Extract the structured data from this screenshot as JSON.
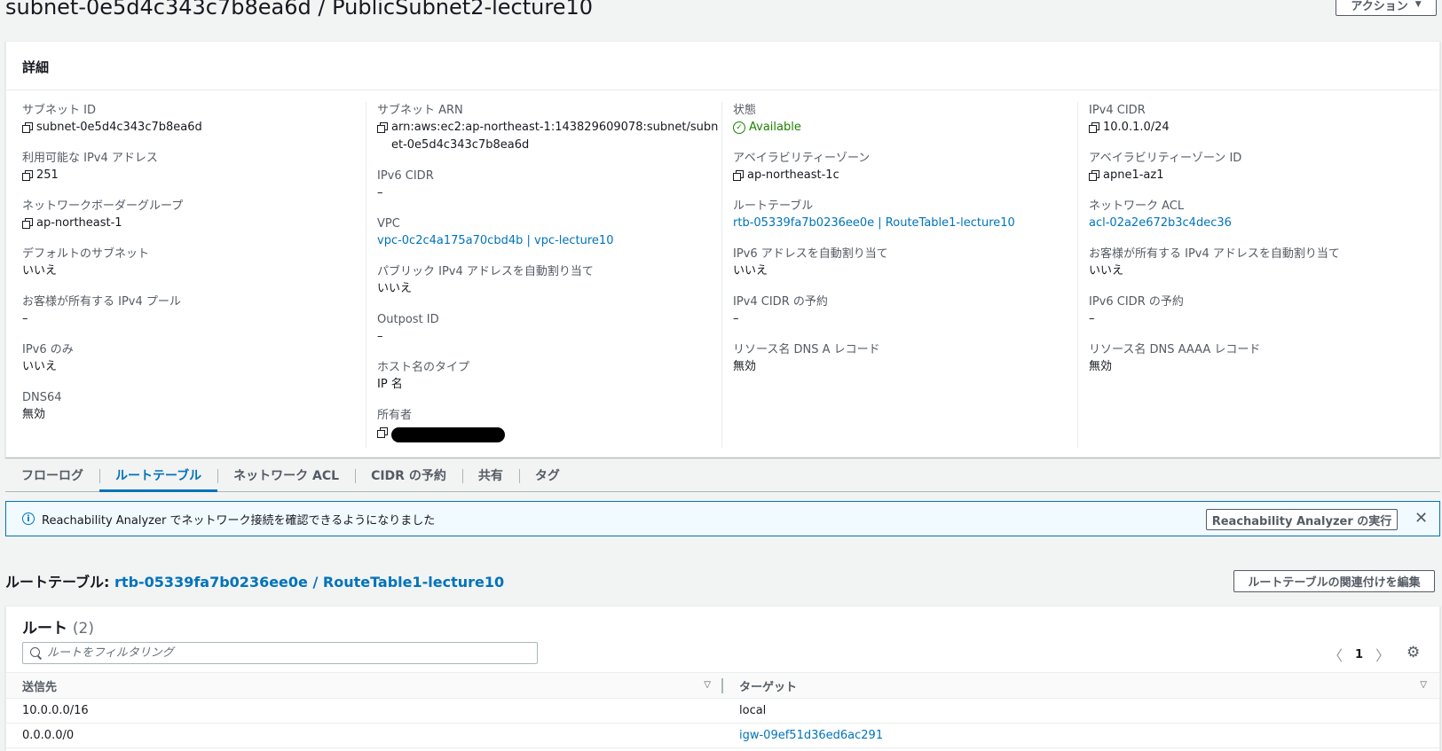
{
  "page": {
    "title": "subnet-0e5d4c343c7b8ea6d / PublicSubnet2-lecture10",
    "actions_label": "アクション"
  },
  "details": {
    "heading": "詳細",
    "subnet_id_label": "サブネット ID",
    "subnet_id_value": "subnet-0e5d4c343c7b8ea6d",
    "available_ipv4_label": "利用可能な IPv4 アドレス",
    "available_ipv4_value": "251",
    "network_border_group_label": "ネットワークボーダーグループ",
    "network_border_group_value": "ap-northeast-1",
    "default_subnet_label": "デフォルトのサブネット",
    "default_subnet_value": "いいえ",
    "customer_owned_pool_label": "お客様が所有する IPv4 プール",
    "customer_owned_pool_value": "–",
    "ipv6_only_label": "IPv6 のみ",
    "ipv6_only_value": "いいえ",
    "dns64_label": "DNS64",
    "dns64_value": "無効",
    "subnet_arn_label": "サブネット ARN",
    "subnet_arn_value": "arn:aws:ec2:ap-northeast-1:143829609078:subnet/subnet-0e5d4c343c7b8ea6d",
    "ipv6_cidr_label": "IPv6 CIDR",
    "ipv6_cidr_value": "–",
    "vpc_label": "VPC",
    "vpc_value": "vpc-0c2c4a175a70cbd4b | vpc-lecture10",
    "auto_assign_public_ipv4_label": "パブリック IPv4 アドレスを自動割り当て",
    "auto_assign_public_ipv4_value": "いいえ",
    "outpost_id_label": "Outpost ID",
    "outpost_id_value": "–",
    "hostname_type_label": "ホスト名のタイプ",
    "hostname_type_value": "IP 名",
    "owner_label": "所有者",
    "state_label": "状態",
    "state_value": "Available",
    "az_label": "アベイラビリティーゾーン",
    "az_value": "ap-northeast-1c",
    "route_table_label": "ルートテーブル",
    "route_table_value": "rtb-05339fa7b0236ee0e | RouteTable1-lecture10",
    "auto_assign_ipv6_label": "IPv6 アドレスを自動割り当て",
    "auto_assign_ipv6_value": "いいえ",
    "ipv4_cidr_reservation_label": "IPv4 CIDR の予約",
    "ipv4_cidr_reservation_value": "–",
    "dns_a_record_label": "リソース名 DNS A レコード",
    "dns_a_record_value": "無効",
    "ipv4_cidr_label": "IPv4 CIDR",
    "ipv4_cidr_value": "10.0.1.0/24",
    "az_id_label": "アベイラビリティーゾーン ID",
    "az_id_value": "apne1-az1",
    "network_acl_label": "ネットワーク ACL",
    "network_acl_value": "acl-02a2e672b3c4dec36",
    "auto_assign_customer_ipv4_label": "お客様が所有する IPv4 アドレスを自動割り当て",
    "auto_assign_customer_ipv4_value": "いいえ",
    "ipv6_cidr_reservation_label": "IPv6 CIDR の予約",
    "ipv6_cidr_reservation_value": "–",
    "dns_aaaa_record_label": "リソース名 DNS AAAA レコード",
    "dns_aaaa_record_value": "無効"
  },
  "tabs": [
    {
      "label": "フローログ"
    },
    {
      "label": "ルートテーブル"
    },
    {
      "label": "ネットワーク ACL"
    },
    {
      "label": "CIDR の予約"
    },
    {
      "label": "共有"
    },
    {
      "label": "タグ"
    }
  ],
  "flash": {
    "text": "Reachability Analyzer でネットワーク接続を確認できるようになりました",
    "button_label": "Reachability Analyzer の実行"
  },
  "route_table_section": {
    "title_prefix": "ルートテーブル:",
    "title_link": "rtb-05339fa7b0236ee0e / RouteTable1-lecture10",
    "edit_assoc_label": "ルートテーブルの関連付けを編集"
  },
  "routes": {
    "heading": "ルート",
    "count": "(2)",
    "filter_placeholder": "ルートをフィルタリング",
    "page_number": "1",
    "columns": [
      "送信先",
      "ターゲット"
    ],
    "rows": [
      {
        "destination": "10.0.0.0/16",
        "target": "local"
      },
      {
        "destination": "0.0.0.0/0",
        "target": "igw-09ef51d36ed6ac291"
      }
    ]
  }
}
